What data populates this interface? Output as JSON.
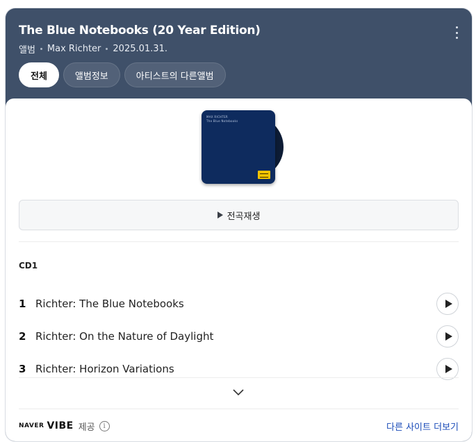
{
  "header": {
    "title": "The Blue Notebooks (20 Year Edition)",
    "type": "앨범",
    "artist": "Max Richter",
    "date": "2025.01.31."
  },
  "tabs": [
    {
      "label": "전체",
      "active": true
    },
    {
      "label": "앨범정보",
      "active": false
    },
    {
      "label": "아티스트의 다른앨범",
      "active": false
    }
  ],
  "album": {
    "cover_line1": "MAX RICHTER",
    "cover_line2": "The Blue Notebooks",
    "cover_color": "#0e2b5e"
  },
  "play_all_label": "전곡재생",
  "cd_label": "CD1",
  "tracks": [
    {
      "num": "1",
      "title": "Richter: The Blue Notebooks"
    },
    {
      "num": "2",
      "title": "Richter: On the Nature of Daylight"
    },
    {
      "num": "3",
      "title": "Richter: Horizon Variations"
    }
  ],
  "footer": {
    "brand_naver": "NAVER",
    "brand_vibe": "VIBE",
    "provided": "제공",
    "more_link": "다른 사이트 더보기"
  },
  "colors": {
    "header_bg": "#3f5069",
    "link": "#1a4bb8"
  }
}
